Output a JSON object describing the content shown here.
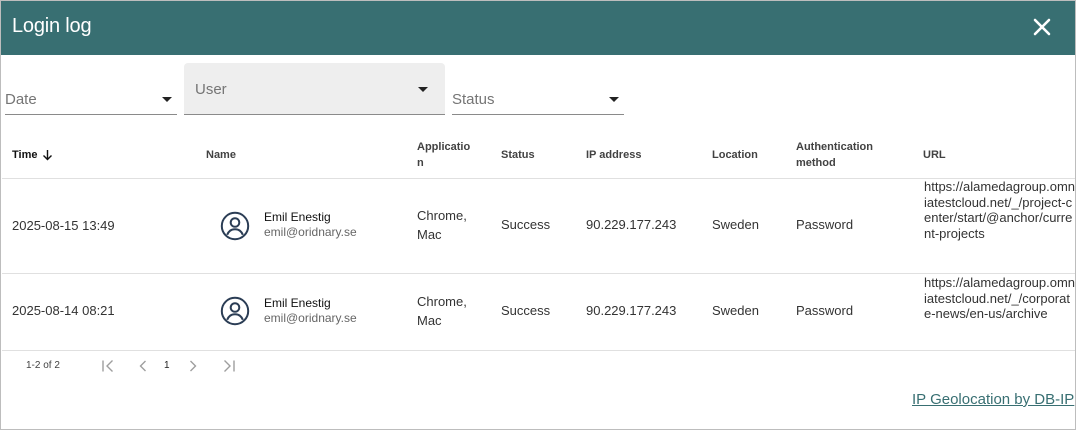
{
  "dialog": {
    "title": "Login log",
    "close_icon": "close-icon"
  },
  "filters": {
    "date": {
      "label": "Date",
      "icon": "dropdown-arrow-icon"
    },
    "user": {
      "label": "User",
      "icon": "dropdown-arrow-icon"
    },
    "status": {
      "label": "Status",
      "icon": "dropdown-arrow-icon"
    }
  },
  "table": {
    "columns": {
      "time": "Time",
      "name": "Name",
      "application": "Application",
      "status": "Status",
      "ip": "IP address",
      "location": "Location",
      "auth": "Authentication method",
      "url": "URL"
    },
    "sort": {
      "column": "time",
      "direction": "descending",
      "icon": "arrow-down-icon"
    },
    "rows": [
      {
        "time": "2025-08-15 13:49",
        "avatar_icon": "user-avatar-icon",
        "name": "Emil Enestig",
        "email": "emil@oridnary.se",
        "application": "Chrome, Mac",
        "status": "Success",
        "ip": "90.229.177.243",
        "location": "Sweden",
        "auth": "Password",
        "url": "https://alamedagroup.omniatestcloud.net/_/project-center/start/@anchor/current-projects"
      },
      {
        "time": "2025-08-14 08:21",
        "avatar_icon": "user-avatar-icon",
        "name": "Emil Enestig",
        "email": "emil@oridnary.se",
        "application": "Chrome, Mac",
        "status": "Success",
        "ip": "90.229.177.243",
        "location": "Sweden",
        "auth": "Password",
        "url": "https://alamedagroup.omniatestcloud.net/_/corporate-news/en-us/archive"
      }
    ]
  },
  "pagination": {
    "range": "1-2 of 2",
    "page": "1",
    "icons": [
      "first-page-icon",
      "previous-page-icon",
      "next-page-icon",
      "last-page-icon"
    ]
  },
  "footer": {
    "link": "IP Geolocation by DB-IP"
  },
  "colors": {
    "header_bg": "#386f72",
    "link": "#386f72"
  }
}
